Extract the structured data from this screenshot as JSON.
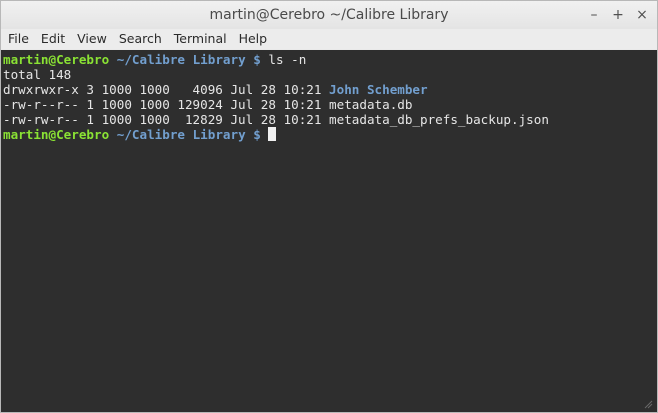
{
  "window": {
    "title": "martin@Cerebro ~/Calibre Library",
    "buttons": {
      "minimize": "–",
      "maximize": "+",
      "close": "×"
    }
  },
  "menubar": {
    "items": [
      "File",
      "Edit",
      "View",
      "Search",
      "Terminal",
      "Help"
    ]
  },
  "terminal": {
    "colors": {
      "background": "#2e2e2e",
      "prompt_user": "#8ae234",
      "prompt_path": "#729fcf",
      "directory": "#729fcf"
    },
    "prompt1": {
      "user": "martin@Cerebro",
      "path": "~/Calibre Library $",
      "command": " ls -n"
    },
    "total": "total 148",
    "rows": [
      {
        "meta": "drwxrwxr-x 3 1000 1000   4096 Jul 28 10:21 ",
        "name": "John Schember"
      },
      {
        "meta": "-rw-r--r-- 1 1000 1000 129024 Jul 28 10:21 ",
        "name": "metadata.db"
      },
      {
        "meta": "-rw-rw-r-- 1 1000 1000  12829 Jul 28 10:21 ",
        "name": "metadata_db_prefs_backup.json"
      }
    ],
    "prompt2": {
      "user": "martin@Cerebro",
      "path": "~/Calibre Library $",
      "command": " "
    }
  }
}
